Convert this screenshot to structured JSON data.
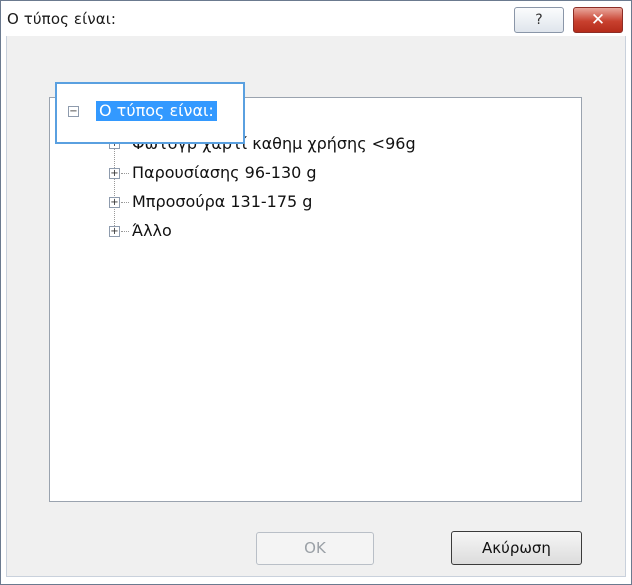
{
  "window": {
    "title": "Ο τύπος είναι:",
    "help_label": "?",
    "close_label": "✕"
  },
  "tree": {
    "root": {
      "label": "Ο τύπος είναι:",
      "expander": "−"
    },
    "items": [
      {
        "label": "Φωτογρ χαρτί καθημ χρήσης <96g",
        "expander": "+"
      },
      {
        "label": "Παρουσίασης 96-130 g",
        "expander": "+"
      },
      {
        "label": "Μπροσούρα 131-175 g",
        "expander": "+"
      },
      {
        "label": "Άλλο",
        "expander": "+"
      }
    ]
  },
  "buttons": {
    "ok_label": "OK",
    "cancel_label": "Ακύρωση"
  },
  "colors": {
    "selection": "#3399ff",
    "focus_border": "#5aa0e0",
    "close_button": "#c8402f"
  }
}
